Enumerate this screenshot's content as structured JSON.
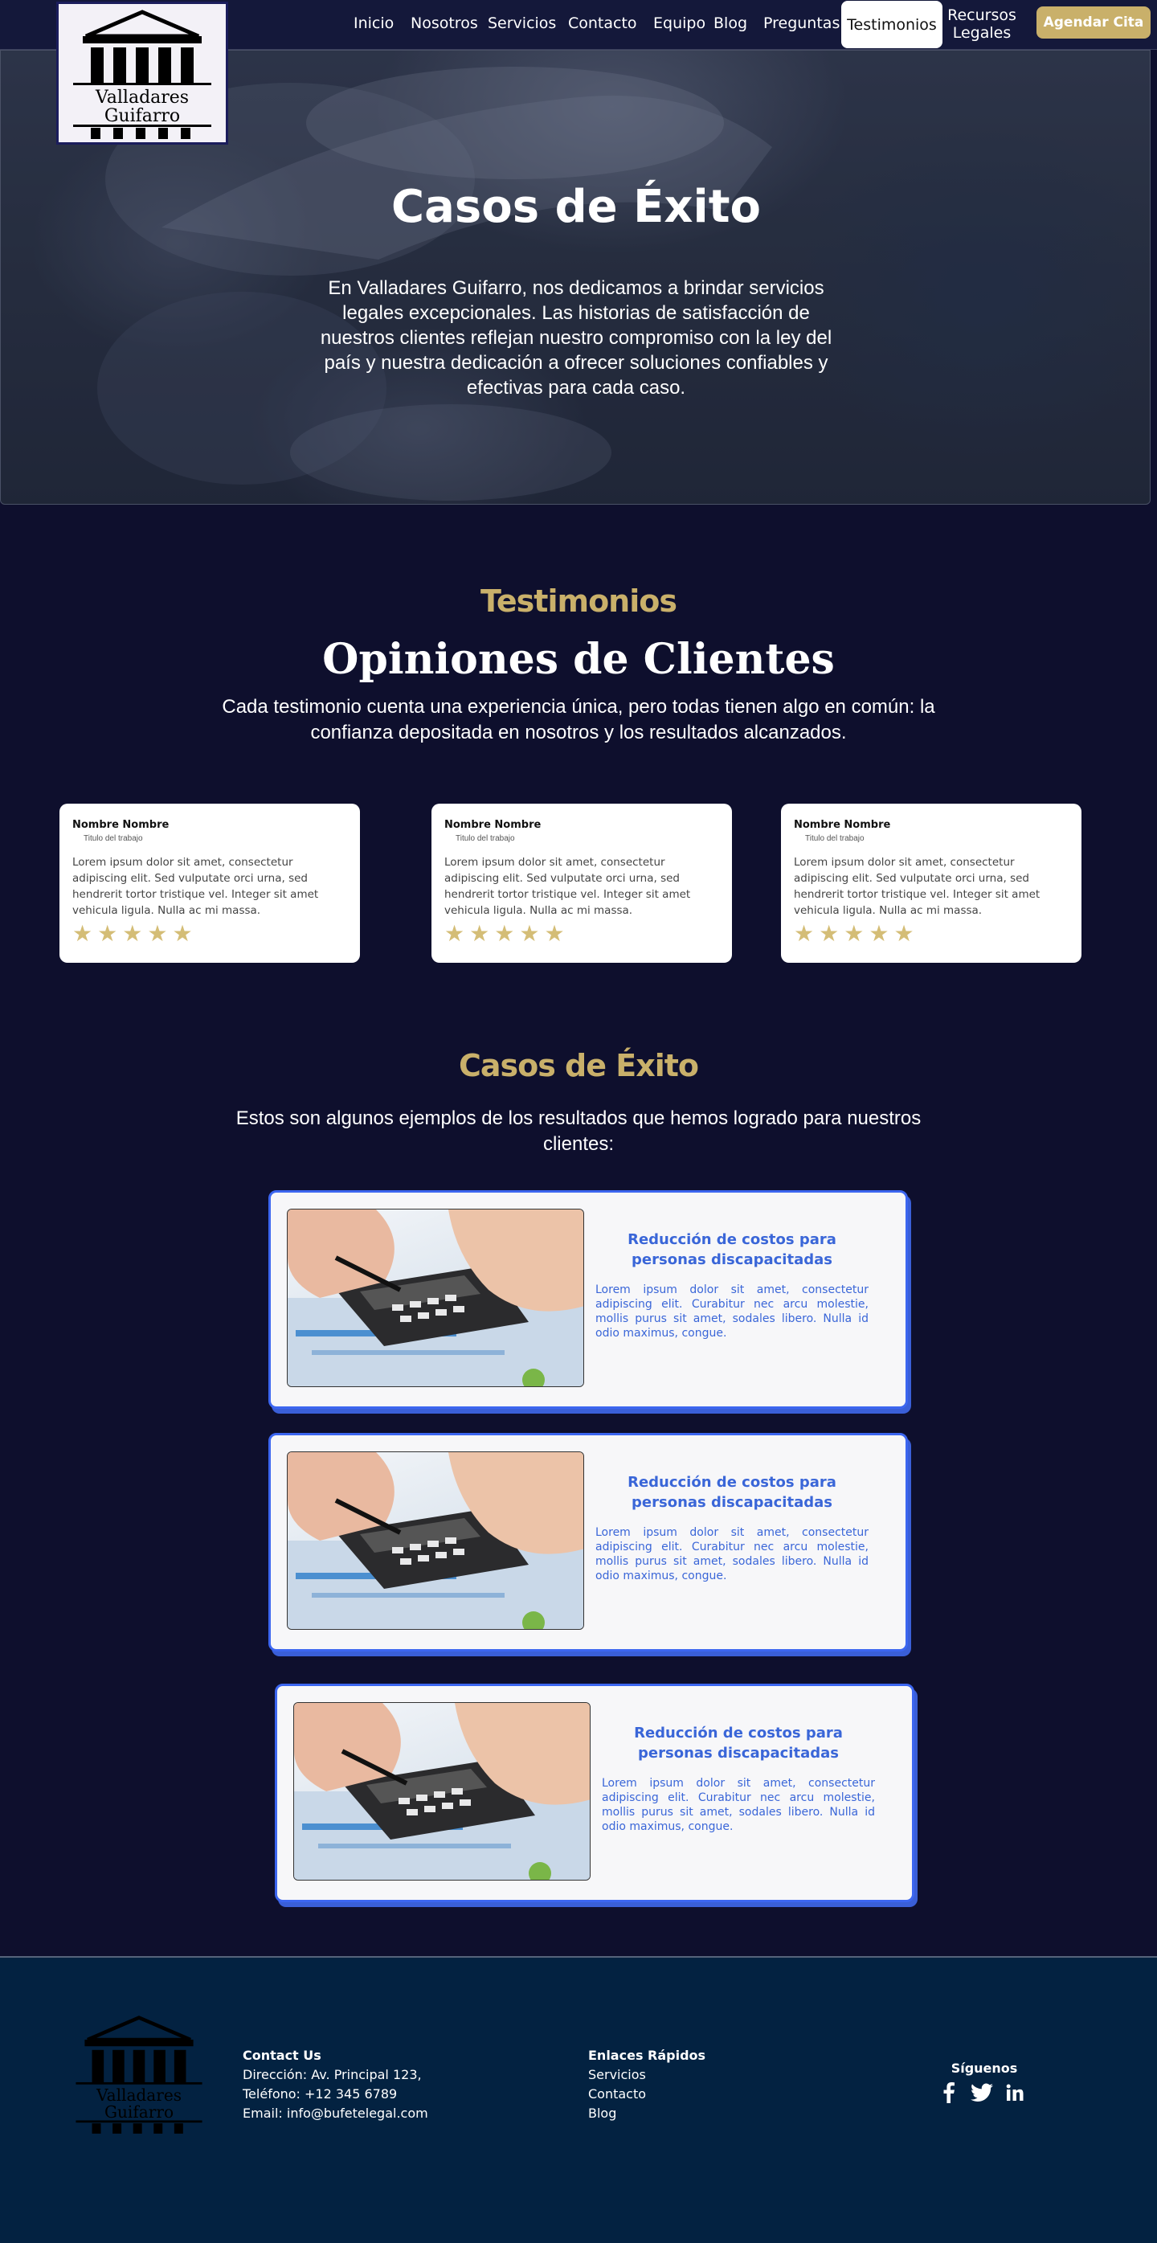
{
  "brand": {
    "line1": "Valladares",
    "line2": "Guifarro"
  },
  "nav": {
    "items": [
      "Inicio",
      "Nosotros",
      "Servicios",
      "Contacto",
      "Equipo",
      "Blog",
      "Preguntas",
      "Testimonios"
    ],
    "recursos": [
      "Recursos",
      "Legales"
    ],
    "cta": "Agendar Cita",
    "colors": {
      "bar": "#14183a",
      "accent": "#c9b06a"
    }
  },
  "hero": {
    "title": "Casos de Éxito",
    "text": "En Valladares Guifarro, nos dedicamos a brindar servicios legales excepcionales. Las historias de satisfacción de nuestros clientes reflejan nuestro compromiso con la ley del país y nuestra dedicación a ofrecer soluciones confiables y efectivas para cada caso."
  },
  "testimonials": {
    "eyebrow": "Testimonios",
    "title": "Opiniones de Clientes",
    "lead": "Cada testimonio cuenta una experiencia única, pero todas tienen algo en común: la confianza depositada en nosotros y los resultados alcanzados.",
    "cards": [
      {
        "name": "Nombre Nombre",
        "role": "Titulo del trabajo",
        "text": "Lorem ipsum dolor sit amet, consectetur adipiscing elit. Sed vulputate orci urna, sed hendrerit tortor tristique vel. Integer sit amet vehicula ligula. Nulla ac mi massa.",
        "rating": 5
      },
      {
        "name": "Nombre Nombre",
        "role": "Titulo del trabajo",
        "text": "Lorem ipsum dolor sit amet, consectetur adipiscing elit. Sed vulputate orci urna, sed hendrerit tortor tristique vel. Integer sit amet vehicula ligula. Nulla ac mi massa.",
        "rating": 5
      },
      {
        "name": "Nombre Nombre",
        "role": "Titulo del trabajo",
        "text": "Lorem ipsum dolor sit amet, consectetur adipiscing elit. Sed vulputate orci urna, sed hendrerit tortor tristique vel. Integer sit amet vehicula ligula. Nulla ac mi massa.",
        "rating": 5
      }
    ]
  },
  "cases": {
    "title": "Casos de Éxito",
    "lead": "Estos son algunos ejemplos de los resultados que hemos logrado para nuestros clientes:",
    "items": [
      {
        "title": "Reducción de costos para personas discapacitadas",
        "text": "Lorem ipsum dolor sit amet, consectetur adipiscing elit. Curabitur nec arcu molestie, mollis purus sit amet, sodales libero. Nulla id odio maximus, congue."
      },
      {
        "title": "Reducción de costos para personas discapacitadas",
        "text": "Lorem ipsum dolor sit amet, consectetur adipiscing elit. Curabitur nec arcu molestie, mollis purus sit amet, sodales libero. Nulla id odio maximus, congue."
      },
      {
        "title": "Reducción de costos para personas discapacitadas",
        "text": "Lorem ipsum dolor sit amet, consectetur adipiscing elit. Curabitur nec arcu molestie, mollis purus sit amet, sodales libero. Nulla id odio maximus, congue."
      }
    ]
  },
  "footer": {
    "contact_heading": "Contact Us",
    "contact_lines": [
      "Dirección: Av. Principal 123,",
      "Teléfono: +12 345 6789",
      "Email: info@bufetelegal.com"
    ],
    "links_heading": "Enlaces Rápidos",
    "links": [
      "Servicios",
      "Contacto",
      "Blog"
    ],
    "social_heading": "Síguenos",
    "social_icons": [
      "facebook-icon",
      "twitter-icon",
      "linkedin-icon"
    ]
  }
}
